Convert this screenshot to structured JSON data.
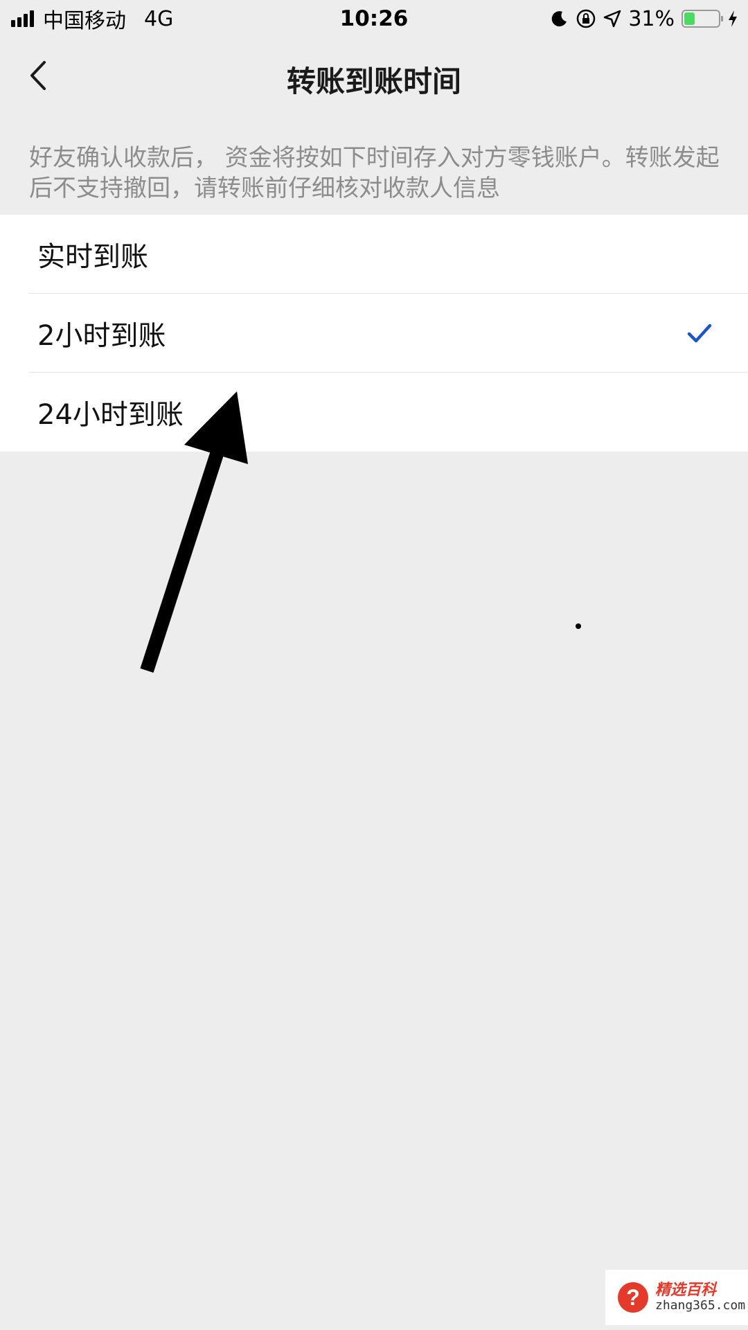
{
  "status_bar": {
    "carrier": "中国移动",
    "network": "4G",
    "time": "10:26",
    "battery_percent": "31%",
    "battery_level": 0.31,
    "icons": [
      "moon-icon",
      "rotation-lock-icon",
      "location-arrow-icon",
      "battery-icon",
      "charging-bolt-icon"
    ]
  },
  "nav": {
    "back_icon": "chevron-left-icon",
    "title": "转账到账时间"
  },
  "description": "好友确认收款后， 资金将按如下时间存入对方零钱账户。转账发起后不支持撤回，请转账前仔细核对收款人信息",
  "options": [
    {
      "label": "实时到账",
      "selected": false
    },
    {
      "label": "2小时到账",
      "selected": true
    },
    {
      "label": "24小时到账",
      "selected": false
    }
  ],
  "colors": {
    "background": "#ededed",
    "accent_check": "#1a56c9",
    "description_text": "#8c8c8c"
  },
  "watermark": {
    "brand": "精选百科",
    "url": "zhang365.com"
  }
}
